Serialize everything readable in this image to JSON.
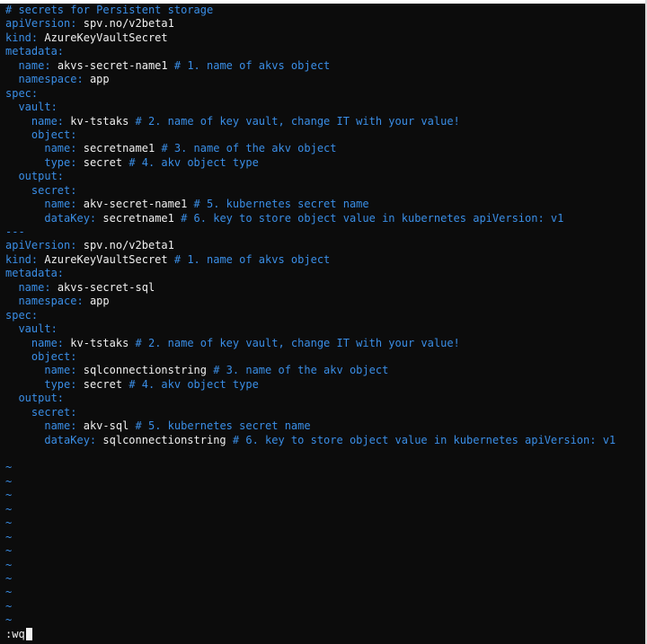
{
  "editor": {
    "lines": [
      {
        "indent": "",
        "comment": "# secrets for Persistent storage"
      },
      {
        "indent": "",
        "key": "apiVersion:",
        "value": "spv.no/v2beta1"
      },
      {
        "indent": "",
        "key": "kind:",
        "value": "AzureKeyVaultSecret"
      },
      {
        "indent": "",
        "key": "metadata:"
      },
      {
        "indent": "  ",
        "key": "name:",
        "value": "akvs-secret-name1",
        "comment": "# 1. name of akvs object"
      },
      {
        "indent": "  ",
        "key": "namespace:",
        "value": "app"
      },
      {
        "indent": "",
        "key": "spec:"
      },
      {
        "indent": "  ",
        "key": "vault:"
      },
      {
        "indent": "    ",
        "key": "name:",
        "value": "kv-tstaks",
        "comment": "# 2. name of key vault, change IT with your value!"
      },
      {
        "indent": "    ",
        "key": "object:"
      },
      {
        "indent": "      ",
        "key": "name:",
        "value": "secretname1",
        "comment": "# 3. name of the akv object"
      },
      {
        "indent": "      ",
        "key": "type:",
        "value": "secret",
        "comment": "# 4. akv object type"
      },
      {
        "indent": "  ",
        "key": "output:"
      },
      {
        "indent": "    ",
        "key": "secret:"
      },
      {
        "indent": "      ",
        "key": "name:",
        "value": "akv-secret-name1",
        "comment": "# 5. kubernetes secret name"
      },
      {
        "indent": "      ",
        "key": "dataKey:",
        "value": "secretname1",
        "comment": "# 6. key to store object value in kubernetes apiVersion: v1"
      },
      {
        "indent": "",
        "comment": "---"
      },
      {
        "indent": "",
        "key": "apiVersion:",
        "value": "spv.no/v2beta1"
      },
      {
        "indent": "",
        "key": "kind:",
        "value": "AzureKeyVaultSecret",
        "comment": "# 1. name of akvs object"
      },
      {
        "indent": "",
        "key": "metadata:"
      },
      {
        "indent": "  ",
        "key": "name:",
        "value": "akvs-secret-sql"
      },
      {
        "indent": "  ",
        "key": "namespace:",
        "value": "app"
      },
      {
        "indent": "",
        "key": "spec:"
      },
      {
        "indent": "  ",
        "key": "vault:"
      },
      {
        "indent": "    ",
        "key": "name:",
        "value": "kv-tstaks",
        "comment": "# 2. name of key vault, change IT with your value!"
      },
      {
        "indent": "    ",
        "key": "object:"
      },
      {
        "indent": "      ",
        "key": "name:",
        "value": "sqlconnectionstring",
        "comment": "# 3. name of the akv object"
      },
      {
        "indent": "      ",
        "key": "type:",
        "value": "secret",
        "comment": "# 4. akv object type"
      },
      {
        "indent": "  ",
        "key": "output:"
      },
      {
        "indent": "    ",
        "key": "secret:"
      },
      {
        "indent": "      ",
        "key": "name:",
        "value": "akv-sql",
        "comment": "# 5. kubernetes secret name"
      },
      {
        "indent": "      ",
        "key": "dataKey:",
        "value": "sqlconnectionstring",
        "comment": "# 6. key to store object value in kubernetes apiVersion: v1"
      },
      {
        "indent": ""
      },
      {
        "tilde": "~"
      },
      {
        "tilde": "~"
      },
      {
        "tilde": "~"
      },
      {
        "tilde": "~"
      },
      {
        "tilde": "~"
      },
      {
        "tilde": "~"
      },
      {
        "tilde": "~"
      },
      {
        "tilde": "~"
      },
      {
        "tilde": "~"
      },
      {
        "tilde": "~"
      },
      {
        "tilde": "~"
      },
      {
        "tilde": "~"
      }
    ],
    "command": ":wq"
  },
  "colors": {
    "background": "#0c0c0c",
    "key": "#3a8ee6",
    "comment": "#3a8ee6",
    "value": "#f0f0f0"
  }
}
